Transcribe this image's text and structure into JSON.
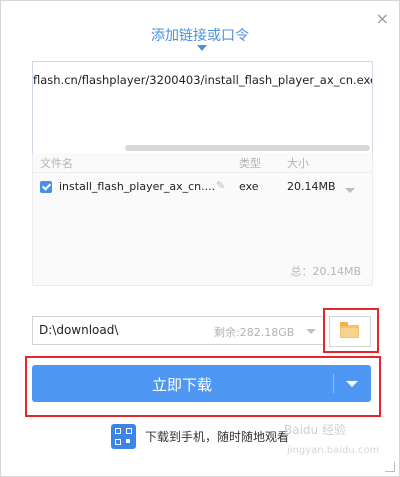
{
  "dialog": {
    "close_symbol": "×",
    "tab_label": "添加链接或口令"
  },
  "url_input": {
    "value": "flash.cn/flashplayer/3200403/install_flash_player_ax_cn.exe"
  },
  "file_list": {
    "headers": {
      "name": "文件名",
      "type": "类型",
      "size": "大小"
    },
    "items": [
      {
        "checked": true,
        "name": "install_flash_player_ax_cn....",
        "type": "exe",
        "size": "20.14MB"
      }
    ],
    "total": "总：20.14MB"
  },
  "save_path": {
    "value": "D:\\download\\",
    "remaining": "剩余:282.18GB"
  },
  "download_button": {
    "label": "立即下载"
  },
  "mobile_link": {
    "label": "下载到手机，随时随地观看"
  },
  "watermark": {
    "text": "Baidu 经验",
    "sub": "jingyan.baidu.com"
  },
  "icons": {
    "close": "close-icon",
    "tab_pointer": "caret-down-icon",
    "checkbox": "checkbox-checked-icon",
    "edit": "pencil-icon",
    "folder": "folder-icon",
    "qr": "qr-code-icon"
  },
  "colors": {
    "accent": "#4a90e2",
    "button": "#4e97f2",
    "highlight": "#e5262b",
    "folder": "#f2c36b"
  }
}
